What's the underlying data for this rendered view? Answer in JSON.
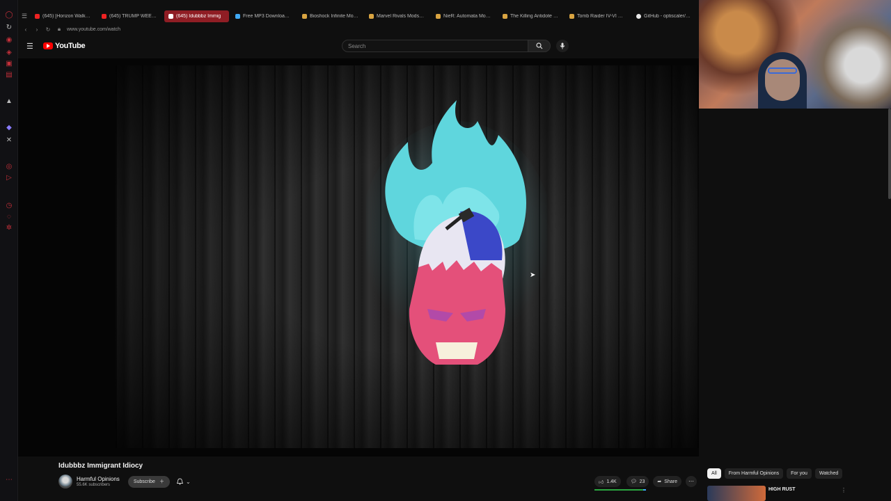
{
  "browser": {
    "tabs": [
      {
        "label": "(645) [Horizon Walker] S",
        "color": "#e22"
      },
      {
        "label": "(645) TRUMP WEED DE",
        "color": "#e22"
      },
      {
        "label": "(645) Idubbbz Immig",
        "color": "#e22",
        "active": true
      },
      {
        "label": "Free MP3 Downloader - S",
        "color": "#3fa9f5"
      },
      {
        "label": "Bioshock Infinite Mods - Ne",
        "color": "#d9a441"
      },
      {
        "label": "Marvel Rivals Mods - Ne",
        "color": "#d9a441"
      },
      {
        "label": "NieR: Automata Mods - N",
        "color": "#d9a441"
      },
      {
        "label": "The Killing Antidote Mod",
        "color": "#d9a441"
      },
      {
        "label": "Tomb Raider IV-VI Remas",
        "color": "#d9a441"
      },
      {
        "label": "GitHub - optiscaler/Opti",
        "color": "#e8e8e8"
      }
    ],
    "url": "www.youtube.com/watch"
  },
  "header": {
    "logo_text": "YouTube",
    "search_placeholder": "Search"
  },
  "video": {
    "title": "Idubbbz Immigrant Idiocy"
  },
  "channel": {
    "name": "Harmful Opinions",
    "subscribers": "55.6K subscribers",
    "subscribe_label": "Subscribe"
  },
  "actions": {
    "likes": "1.4K",
    "comments": "23",
    "share_label": "Share"
  },
  "chips": [
    "All",
    "From Harmful Opinions",
    "For you",
    "Watched"
  ],
  "recommendation": {
    "title": "HIGH RUST"
  },
  "colors": {
    "accent_red": "#ff0000",
    "active_tab": "#8f1d24"
  }
}
